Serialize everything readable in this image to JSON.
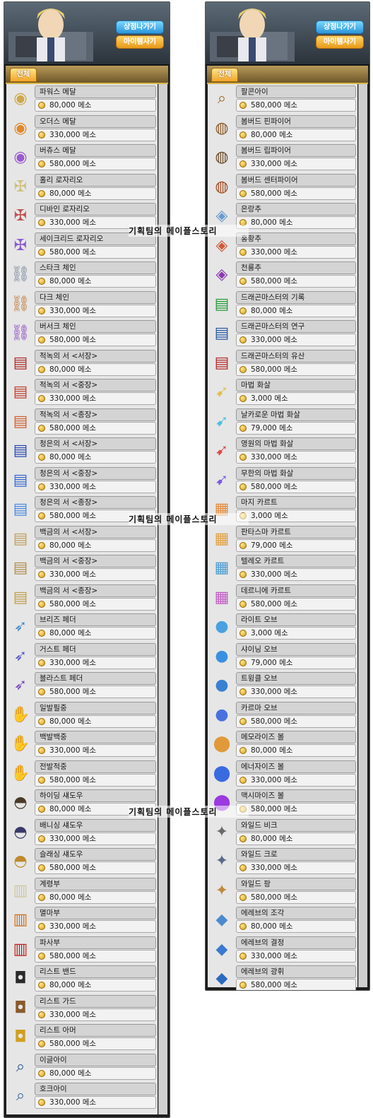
{
  "watermark": "기획팀의 메이플스토리",
  "panels": [
    {
      "exit_label": "상점나가기",
      "buy_label": "아이템사기",
      "tab_label": "전체",
      "items": [
        {
          "name": "파워스 메달",
          "price": "80,000 메소",
          "icon": "medal-icon",
          "color": "#d0a84a"
        },
        {
          "name": "오더스 메달",
          "price": "330,000 메소",
          "icon": "medal-icon",
          "color": "#e08a2a"
        },
        {
          "name": "버츄스 메달",
          "price": "580,000 메소",
          "icon": "medal-icon",
          "color": "#9a5ad0"
        },
        {
          "name": "홀리 로자리오",
          "price": "80,000 메소",
          "icon": "rosary-icon",
          "color": "#d0c080"
        },
        {
          "name": "디바인 로자리오",
          "price": "330,000 메소",
          "icon": "rosary-icon",
          "color": "#c05050"
        },
        {
          "name": "세이크리드 로자리오",
          "price": "580,000 메소",
          "icon": "rosary-icon",
          "color": "#8a5ad0"
        },
        {
          "name": "스타크 체인",
          "price": "80,000 메소",
          "icon": "chain-icon",
          "color": "#7a8a9a"
        },
        {
          "name": "다크 체인",
          "price": "330,000 메소",
          "icon": "chain-icon",
          "color": "#c07a3a"
        },
        {
          "name": "버서크 체인",
          "price": "580,000 메소",
          "icon": "chain-icon",
          "color": "#8a4ac0"
        },
        {
          "name": "적녹의 서 <서장>",
          "price": "80,000 메소",
          "icon": "book-icon",
          "color": "#b02a2a"
        },
        {
          "name": "적녹의 서 <중장>",
          "price": "330,000 메소",
          "icon": "book-icon",
          "color": "#c04030"
        },
        {
          "name": "적녹의 서 <종장>",
          "price": "580,000 메소",
          "icon": "book-icon",
          "color": "#d06030"
        },
        {
          "name": "청은의 서 <서장>",
          "price": "80,000 메소",
          "icon": "book-icon",
          "color": "#2a4ab0"
        },
        {
          "name": "청은의 서 <중장>",
          "price": "330,000 메소",
          "icon": "book-icon",
          "color": "#3a6ad0"
        },
        {
          "name": "청은의 서 <종장>",
          "price": "580,000 메소",
          "icon": "book-icon",
          "color": "#4a8ae0"
        },
        {
          "name": "백금의 서 <서장>",
          "price": "80,000 메소",
          "icon": "book-icon",
          "color": "#c0a060"
        },
        {
          "name": "백금의 서 <중장>",
          "price": "330,000 메소",
          "icon": "book-icon",
          "color": "#b09050"
        },
        {
          "name": "백금의 서 <종장>",
          "price": "580,000 메소",
          "icon": "book-icon",
          "color": "#c0a050"
        },
        {
          "name": "브리즈 페더",
          "price": "80,000 메소",
          "icon": "feather-icon",
          "color": "#4a8ad0"
        },
        {
          "name": "거스트 페더",
          "price": "330,000 메소",
          "icon": "feather-icon",
          "color": "#5a5ad0"
        },
        {
          "name": "블라스트 페더",
          "price": "580,000 메소",
          "icon": "feather-icon",
          "color": "#7a4ac0"
        },
        {
          "name": "일발필중",
          "price": "80,000 메소",
          "icon": "glove-icon",
          "color": "#6a4a2a"
        },
        {
          "name": "백발백중",
          "price": "330,000 메소",
          "icon": "glove-icon",
          "color": "#5a3a2a"
        },
        {
          "name": "전발적중",
          "price": "580,000 메소",
          "icon": "glove-icon",
          "color": "#c09020"
        },
        {
          "name": "하이딩 섀도우",
          "price": "80,000 메소",
          "icon": "hat-icon",
          "color": "#4a3a2a"
        },
        {
          "name": "배니싱 섀도우",
          "price": "330,000 메소",
          "icon": "hat-icon",
          "color": "#3a3a6a"
        },
        {
          "name": "슬래싱 섀도우",
          "price": "580,000 메소",
          "icon": "hat-icon",
          "color": "#c08a2a"
        },
        {
          "name": "계령부",
          "price": "80,000 메소",
          "icon": "talisman-icon",
          "color": "#d0c8a0"
        },
        {
          "name": "멸마부",
          "price": "330,000 메소",
          "icon": "talisman-icon",
          "color": "#d07020"
        },
        {
          "name": "파사부",
          "price": "580,000 메소",
          "icon": "talisman-icon",
          "color": "#c02020"
        },
        {
          "name": "리스트 밴드",
          "price": "80,000 메소",
          "icon": "wristband-icon",
          "color": "#2a2a2a"
        },
        {
          "name": "리스트 가드",
          "price": "330,000 메소",
          "icon": "wristband-icon",
          "color": "#8a5a2a"
        },
        {
          "name": "리스트 아머",
          "price": "580,000 메소",
          "icon": "wristband-icon",
          "color": "#d0a020"
        },
        {
          "name": "이글아이",
          "price": "80,000 메소",
          "icon": "telescope-icon",
          "color": "#2a5a8a"
        },
        {
          "name": "호크아이",
          "price": "330,000 메소",
          "icon": "telescope-icon",
          "color": "#3a6a9a"
        }
      ]
    },
    {
      "exit_label": "상점나가기",
      "buy_label": "아이템사기",
      "tab_label": "전체",
      "items": [
        {
          "name": "팔콘아이",
          "price": "580,000 메소",
          "icon": "telescope-icon",
          "color": "#9a6a2a"
        },
        {
          "name": "봄버드 핀파이어",
          "price": "80,000 메소",
          "icon": "barrel-icon",
          "color": "#8a5a2a"
        },
        {
          "name": "봄버드 립파이어",
          "price": "330,000 메소",
          "icon": "barrel-icon",
          "color": "#6a4a2a"
        },
        {
          "name": "봄버드 센터파이어",
          "price": "580,000 메소",
          "icon": "barrel-icon",
          "color": "#a04a20"
        },
        {
          "name": "은랑추",
          "price": "80,000 메소",
          "icon": "pendulum-icon",
          "color": "#6a9ad0"
        },
        {
          "name": "홍황추",
          "price": "330,000 메소",
          "icon": "pendulum-icon",
          "color": "#d05a3a"
        },
        {
          "name": "천룡추",
          "price": "580,000 메소",
          "icon": "pendulum-icon",
          "color": "#8a3ab0"
        },
        {
          "name": "드래곤마스터의 기록",
          "price": "80,000 메소",
          "icon": "book-icon",
          "color": "#2a9a3a"
        },
        {
          "name": "드래곤마스터의 연구",
          "price": "330,000 메소",
          "icon": "book-icon",
          "color": "#2a5aa0"
        },
        {
          "name": "드래곤마스터의 유산",
          "price": "580,000 메소",
          "icon": "book-icon",
          "color": "#b02a2a"
        },
        {
          "name": "마법 화살",
          "price": "3,000 메소",
          "icon": "arrow-icon",
          "color": "#e0c050"
        },
        {
          "name": "날카로운 마법 화살",
          "price": "79,000 메소",
          "icon": "arrow-icon",
          "color": "#4ac0e0"
        },
        {
          "name": "영원의 마법 화살",
          "price": "330,000 메소",
          "icon": "arrow-icon",
          "color": "#e04a4a"
        },
        {
          "name": "무한의 마법 화살",
          "price": "580,000 메소",
          "icon": "arrow-icon",
          "color": "#7a5ae0"
        },
        {
          "name": "마지 카르트",
          "price": "3,000 메소",
          "icon": "card-icon",
          "color": "#e08a3a"
        },
        {
          "name": "판타스마 카르트",
          "price": "79,000 메소",
          "icon": "card-icon",
          "color": "#e0a040"
        },
        {
          "name": "텔레오 카르트",
          "price": "330,000 메소",
          "icon": "card-icon",
          "color": "#4a9ad0"
        },
        {
          "name": "데르니에 카르트",
          "price": "580,000 메소",
          "icon": "card-icon",
          "color": "#c05ac0"
        },
        {
          "name": "라이트 오브",
          "price": "3,000 메소",
          "icon": "orb-icon",
          "color": "#4aa0e0"
        },
        {
          "name": "샤이닝 오브",
          "price": "79,000 메소",
          "icon": "orb-icon",
          "color": "#3a90e0"
        },
        {
          "name": "트윙클 오브",
          "price": "330,000 메소",
          "icon": "orb-icon",
          "color": "#3a80d0"
        },
        {
          "name": "카르마 오브",
          "price": "580,000 메소",
          "icon": "orb-icon",
          "color": "#4a70e0"
        },
        {
          "name": "메모라이즈 볼",
          "price": "80,000 메소",
          "icon": "ball-icon",
          "color": "#e09a3a"
        },
        {
          "name": "에너자이즈 볼",
          "price": "330,000 메소",
          "icon": "ball-icon",
          "color": "#3a6ae0"
        },
        {
          "name": "맥시마이즈 볼",
          "price": "580,000 메소",
          "icon": "ball-icon",
          "color": "#9a3ae0"
        },
        {
          "name": "와일드 비크",
          "price": "80,000 메소",
          "icon": "claw-icon",
          "color": "#6a6a6a"
        },
        {
          "name": "와일드 크로",
          "price": "330,000 메소",
          "icon": "claw-icon",
          "color": "#5a6a8a"
        },
        {
          "name": "와일드 팡",
          "price": "580,000 메소",
          "icon": "claw-icon",
          "color": "#c08a3a"
        },
        {
          "name": "에레브의 조각",
          "price": "80,000 메소",
          "icon": "jewel-icon",
          "color": "#4a8ad0"
        },
        {
          "name": "에레브의 결정",
          "price": "330,000 메소",
          "icon": "jewel-icon",
          "color": "#3a7ad0"
        },
        {
          "name": "에레브의 광휘",
          "price": "580,000 메소",
          "icon": "jewel-icon",
          "color": "#2a6ac0"
        }
      ]
    }
  ]
}
